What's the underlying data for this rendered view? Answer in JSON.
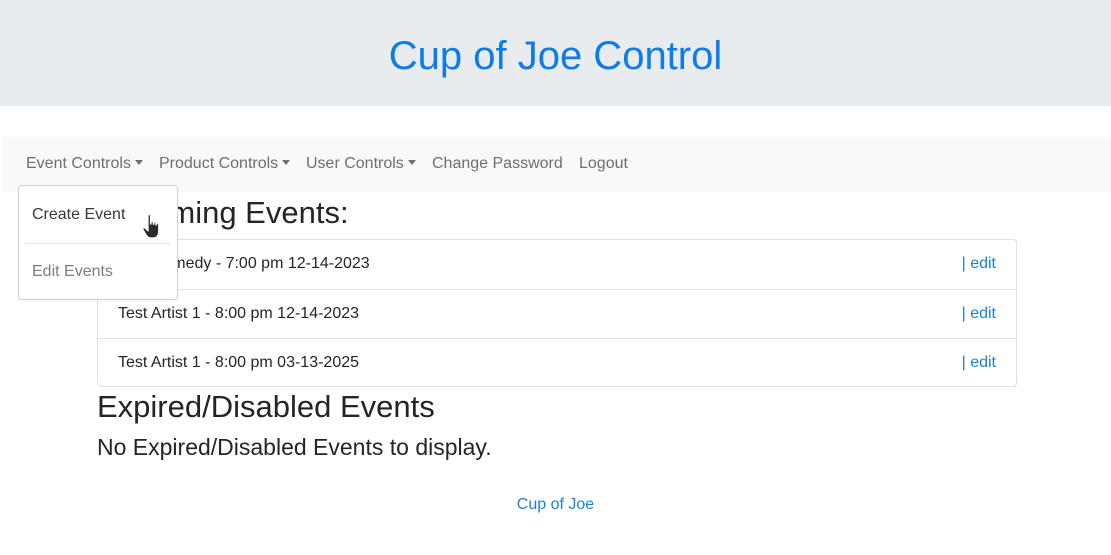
{
  "header": {
    "title": "Cup of Joe Control"
  },
  "nav": {
    "items": [
      {
        "label": "Event Controls",
        "dropdown": true
      },
      {
        "label": "Product Controls",
        "dropdown": true
      },
      {
        "label": "User Controls",
        "dropdown": true
      },
      {
        "label": "Change Password",
        "dropdown": false
      },
      {
        "label": "Logout",
        "dropdown": false
      }
    ]
  },
  "dropdown": {
    "items": [
      {
        "label": "Create Event"
      },
      {
        "label": "Edit Events"
      }
    ]
  },
  "upcoming": {
    "title": "Upcoming Events:",
    "events": [
      {
        "text": "Test Comedy - 7:00 pm 12-14-2023",
        "action": "| edit"
      },
      {
        "text": "Test Artist 1 - 8:00 pm 12-14-2023",
        "action": "| edit"
      },
      {
        "text": "Test Artist 1 - 8:00 pm 03-13-2025",
        "action": "| edit"
      }
    ]
  },
  "expired": {
    "title": "Expired/Disabled Events",
    "empty_message": "No Expired/Disabled Events to display."
  },
  "footer": {
    "link": "Cup of Joe"
  },
  "colors": {
    "brand": "#0d7bea",
    "link": "#1a82d9",
    "header_bg": "#e9ecef",
    "navbar_bg": "#f8f9fa"
  }
}
